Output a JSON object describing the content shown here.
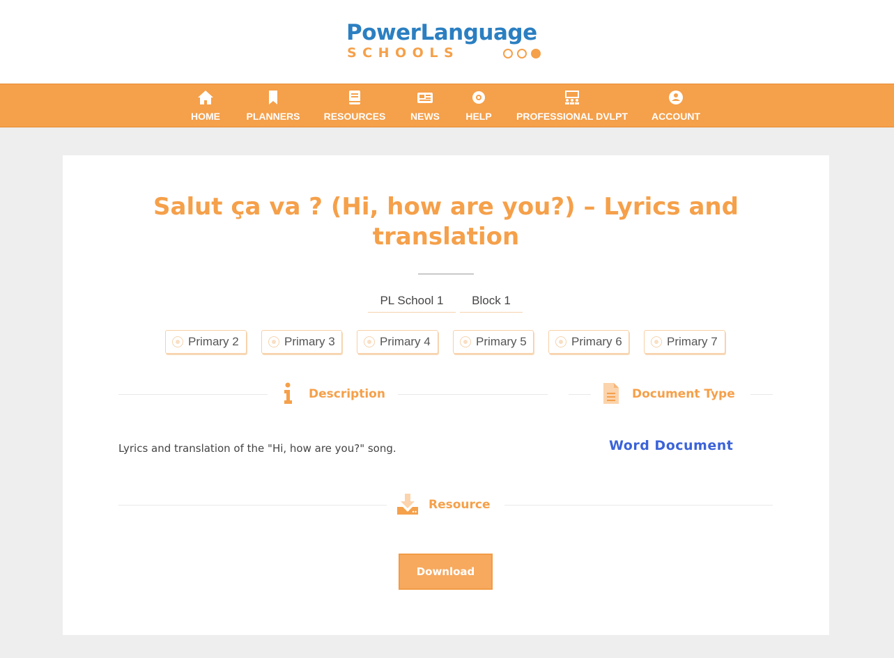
{
  "logo": {
    "brand_top": "PowerLanguage",
    "brand_bottom": "SCHOOLS"
  },
  "nav": {
    "items": [
      {
        "label": "HOME",
        "icon": "home-icon"
      },
      {
        "label": "PLANNERS",
        "icon": "bookmark-icon"
      },
      {
        "label": "RESOURCES",
        "icon": "book-icon"
      },
      {
        "label": "NEWS",
        "icon": "newspaper-icon"
      },
      {
        "label": "HELP",
        "icon": "lifebuoy-icon"
      },
      {
        "label": "PROFESSIONAL DVLPT",
        "icon": "presentation-icon"
      },
      {
        "label": "ACCOUNT",
        "icon": "user-icon"
      }
    ]
  },
  "page": {
    "title": "Salut ça va ? (Hi, how are you?) – Lyrics and translation",
    "tags": [
      "PL School 1",
      "Block 1"
    ],
    "levels": [
      "Primary 2",
      "Primary 3",
      "Primary 4",
      "Primary 5",
      "Primary 6",
      "Primary 7"
    ],
    "description": {
      "heading": "Description",
      "text": "Lyrics and translation of the \"Hi, how are you?\" song."
    },
    "document_type": {
      "heading": "Document Type",
      "value": "Word Document"
    },
    "resource": {
      "heading": "Resource",
      "button": "Download"
    }
  },
  "colors": {
    "accent": "#f5a04a",
    "brand_blue": "#2b7fc1",
    "link_blue": "#3b63d9",
    "background": "#eeeeee"
  }
}
